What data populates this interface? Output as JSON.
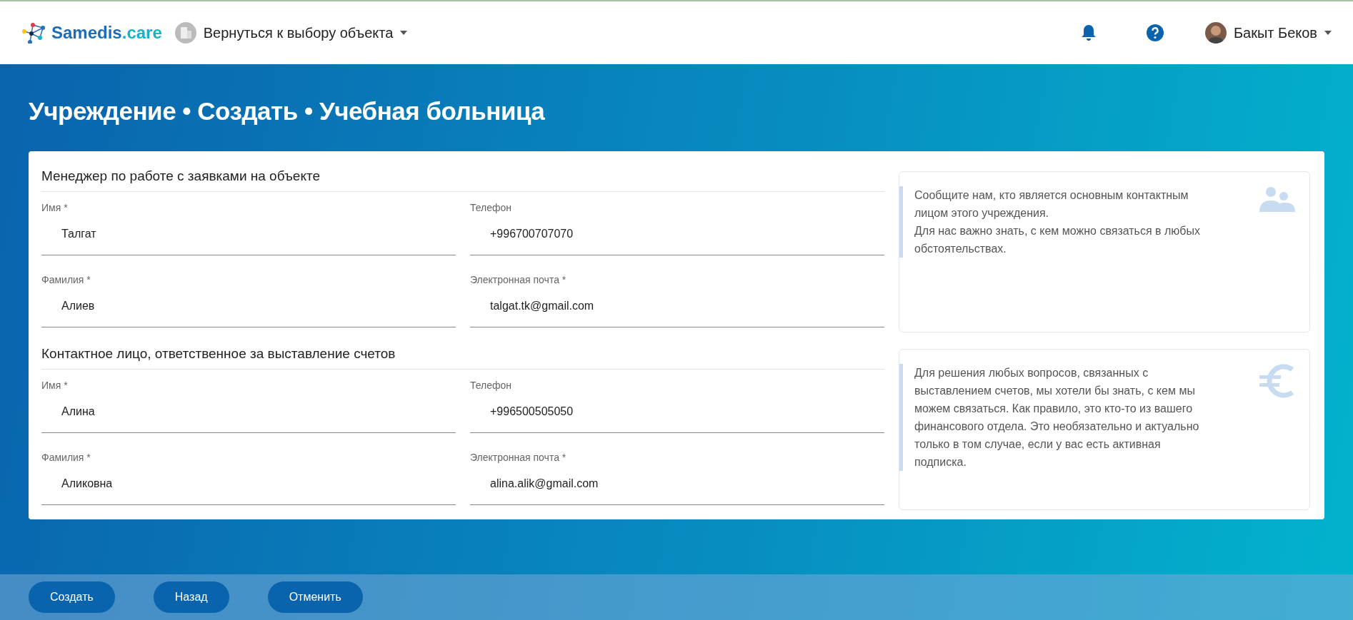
{
  "header": {
    "logo": {
      "main": "Samedis",
      "suffix": ".care"
    },
    "object_switch": {
      "label": "Вернуться к выбору объекта",
      "expanded": false
    },
    "user": "Бакыт Беков"
  },
  "page_title": "Учреждение • Создать • Учебная больница",
  "sections": [
    {
      "title": "Менеджер по работе с заявками на объекте",
      "info": [
        "Сообщите нам, кто является основным контактным лицом этого учреждения.",
        "Для нас важно знать, с кем можно связаться в любых обстоятельствах."
      ],
      "fields": [
        {
          "label": "Имя *",
          "value": "Талгат"
        },
        {
          "label": "Телефон",
          "value": "+996700707070"
        },
        {
          "label": "Фамилия *",
          "value": "Алиев"
        },
        {
          "label": "Электронная почта *",
          "value": "talgat.tk@gmail.com"
        }
      ]
    },
    {
      "title": "Контактное лицо, ответственное за выставление счетов",
      "info": [
        "Для решения любых вопросов, связанных с выставлением счетов, мы хотели бы знать, с кем мы можем связаться. Как правило, это кто-то из вашего финансового отдела. Это необязательно и актуально только в том случае, если у вас есть активная подписка."
      ],
      "fields": [
        {
          "label": "Имя *",
          "value": "Алина"
        },
        {
          "label": "Телефон",
          "value": "+996500505050"
        },
        {
          "label": "Фамилия *",
          "value": "Аликовна"
        },
        {
          "label": "Электронная почта *",
          "value": "alina.alik@gmail.com"
        }
      ]
    }
  ],
  "buttons": [
    "Создать",
    "Назад",
    "Отменить"
  ]
}
